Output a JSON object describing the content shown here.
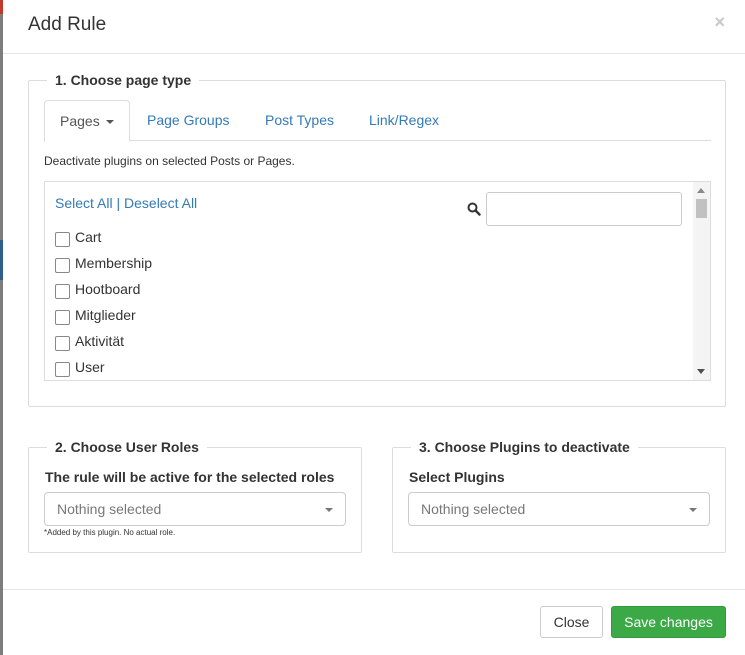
{
  "dialog": {
    "title": "Add Rule",
    "close_icon": "×"
  },
  "section1": {
    "legend": "1. Choose page type",
    "tabs": [
      {
        "label": "Pages",
        "active": true
      },
      {
        "label": "Page Groups",
        "active": false
      },
      {
        "label": "Post Types",
        "active": false
      },
      {
        "label": "Link/Regex",
        "active": false
      }
    ],
    "description": "Deactivate plugins on selected Posts or Pages.",
    "select_all": "Select All",
    "separator": "|",
    "deselect_all": "Deselect All",
    "search": {
      "value": "",
      "icon": "search-icon"
    },
    "items": [
      "Cart",
      "Membership",
      "Hootboard",
      "Mitglieder",
      "Aktivität",
      "User"
    ]
  },
  "section2": {
    "legend": "2. Choose User Roles",
    "label": "The rule will be active for the selected roles",
    "select_value": "Nothing selected",
    "note": "*Added by this plugin. No actual role."
  },
  "section3": {
    "legend": "3. Choose Plugins to deactivate",
    "label": "Select Plugins",
    "select_value": "Nothing selected"
  },
  "footer": {
    "close_label": "Close",
    "save_label": "Save changes"
  },
  "colors": {
    "link": "#337ab7",
    "save_button": "#3aa946"
  }
}
